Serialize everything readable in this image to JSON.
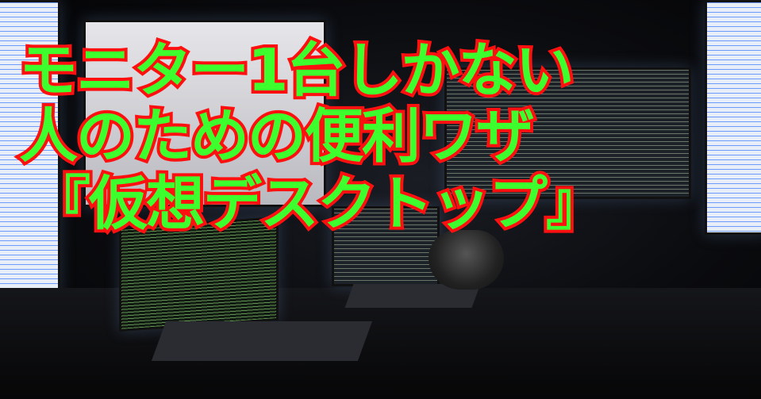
{
  "headline": {
    "line1": "モニター1台しかない",
    "line2": "人のための便利ワザ",
    "line3": "『仮想デスクトップ』"
  },
  "colors": {
    "text_fill": "#3dff2e",
    "text_outline": "#ff1010",
    "background": "#050608"
  }
}
